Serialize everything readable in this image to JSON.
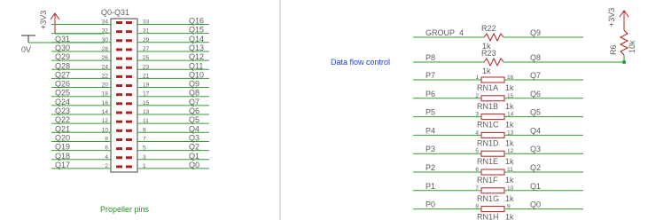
{
  "left_panel": {
    "header_designator": "Q0-Q31",
    "power_label": "+3V3",
    "ground_label": "0V",
    "caption": "Propeller pins",
    "rows": [
      {
        "left_net": "",
        "left_pin": "34",
        "right_pin": "33",
        "right_net": "Q16"
      },
      {
        "left_net": "",
        "left_pin": "32",
        "right_pin": "31",
        "right_net": "Q15"
      },
      {
        "left_net": "Q31",
        "left_pin": "30",
        "right_pin": "29",
        "right_net": "Q14"
      },
      {
        "left_net": "Q30",
        "left_pin": "28",
        "right_pin": "27",
        "right_net": "Q13"
      },
      {
        "left_net": "Q29",
        "left_pin": "26",
        "right_pin": "25",
        "right_net": "Q12"
      },
      {
        "left_net": "Q28",
        "left_pin": "24",
        "right_pin": "23",
        "right_net": "Q11"
      },
      {
        "left_net": "Q27",
        "left_pin": "22",
        "right_pin": "21",
        "right_net": "Q10"
      },
      {
        "left_net": "Q26",
        "left_pin": "20",
        "right_pin": "19",
        "right_net": "Q9"
      },
      {
        "left_net": "Q25",
        "left_pin": "18",
        "right_pin": "17",
        "right_net": "Q8"
      },
      {
        "left_net": "Q24",
        "left_pin": "16",
        "right_pin": "15",
        "right_net": "Q7"
      },
      {
        "left_net": "Q23",
        "left_pin": "14",
        "right_pin": "13",
        "right_net": "Q6"
      },
      {
        "left_net": "Q22",
        "left_pin": "12",
        "right_pin": "11",
        "right_net": "Q5"
      },
      {
        "left_net": "Q21",
        "left_pin": "10",
        "right_pin": "9",
        "right_net": "Q4"
      },
      {
        "left_net": "Q20",
        "left_pin": "8",
        "right_pin": "7",
        "right_net": "Q3"
      },
      {
        "left_net": "Q19",
        "left_pin": "6",
        "right_pin": "5",
        "right_net": "Q2"
      },
      {
        "left_net": "Q18",
        "left_pin": "4",
        "right_pin": "3",
        "right_net": "Q1"
      },
      {
        "left_net": "Q17",
        "left_pin": "2",
        "right_pin": "1",
        "right_net": "Q0"
      }
    ]
  },
  "right_panel": {
    "power_label": "+3V3",
    "pullup": {
      "name": "R6",
      "value": "10k"
    },
    "data_flow_label": "Data flow control",
    "r22": {
      "left_net": "GROUP_4",
      "name": "R22",
      "value": "1k",
      "right_net": "Q9"
    },
    "r23": {
      "left_net": "P8",
      "name": "R23",
      "value": "1k",
      "right_net": "Q8"
    },
    "network": [
      {
        "left_net": "P7",
        "left_pin": "1",
        "right_pin": "16",
        "right_net": "Q7",
        "name": "RN1A",
        "value": "1k"
      },
      {
        "left_net": "P6",
        "left_pin": "2",
        "right_pin": "15",
        "right_net": "Q6",
        "name": "RN1B",
        "value": "1k"
      },
      {
        "left_net": "P5",
        "left_pin": "3",
        "right_pin": "14",
        "right_net": "Q5",
        "name": "RN1C",
        "value": "1k"
      },
      {
        "left_net": "P4",
        "left_pin": "4",
        "right_pin": "13",
        "right_net": "Q4",
        "name": "RN1D",
        "value": "1k"
      },
      {
        "left_net": "P3",
        "left_pin": "5",
        "right_pin": "12",
        "right_net": "Q3",
        "name": "RN1E",
        "value": "1k"
      },
      {
        "left_net": "P2",
        "left_pin": "6",
        "right_pin": "11",
        "right_net": "Q2",
        "name": "RN1F",
        "value": "1k"
      },
      {
        "left_net": "P1",
        "left_pin": "7",
        "right_pin": "10",
        "right_net": "Q1",
        "name": "RN1G",
        "value": "1k"
      },
      {
        "left_net": "P0",
        "left_pin": "8",
        "right_pin": "9",
        "right_net": "Q0",
        "name": "RN1H",
        "value": "1k"
      }
    ]
  }
}
